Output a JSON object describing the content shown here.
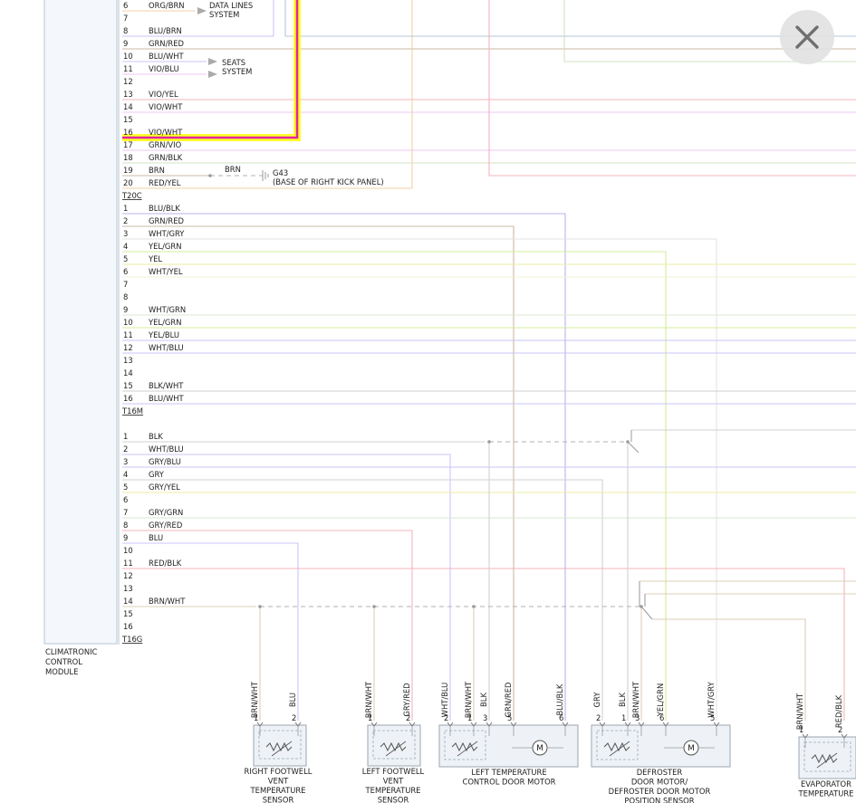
{
  "colors": {
    "wire_grn_red": "#cbb9a6",
    "wire_blu_blk": "#b7b3ee",
    "wire_wht_gry": "#e6e6e6",
    "wire_yel_grn": "#d6ec9c",
    "wire_yel": "#eeeea6",
    "wire_wht_grn": "#dcead2",
    "wire_blu": "#c9c5f7",
    "wire_gry": "#d2d2d2",
    "wire_red": "#f4b3bb",
    "wire_vio": "#ecc7f6",
    "wire_org": "#f6cfa5",
    "highlight_yellow": "#ffff2a",
    "highlight_magenta": "#e0259e",
    "module_fill": "#f4f8fc"
  },
  "module": {
    "name_lines": [
      "CLIMATRONIC",
      "CONTROL",
      "MODULE"
    ]
  },
  "connectors": [
    {
      "id": "T20C",
      "pins": [
        {
          "n": "6",
          "color": "ORG/BRN"
        },
        {
          "n": "7",
          "color": ""
        },
        {
          "n": "8",
          "color": "BLU/BRN"
        },
        {
          "n": "9",
          "color": "GRN/RED"
        },
        {
          "n": "10",
          "color": "BLU/WHT"
        },
        {
          "n": "11",
          "color": "VIO/BLU"
        },
        {
          "n": "12",
          "color": ""
        },
        {
          "n": "13",
          "color": "VIO/YEL"
        },
        {
          "n": "14",
          "color": "VIO/WHT"
        },
        {
          "n": "15",
          "color": ""
        },
        {
          "n": "16",
          "color": "VIO/WHT"
        },
        {
          "n": "17",
          "color": "GRN/VIO"
        },
        {
          "n": "18",
          "color": "GRN/BLK"
        },
        {
          "n": "19",
          "color": "BRN"
        },
        {
          "n": "20",
          "color": "RED/YEL"
        }
      ]
    },
    {
      "id": "T16M",
      "pins": [
        {
          "n": "1",
          "color": "BLU/BLK"
        },
        {
          "n": "2",
          "color": "GRN/RED"
        },
        {
          "n": "3",
          "color": "WHT/GRY"
        },
        {
          "n": "4",
          "color": "YEL/GRN"
        },
        {
          "n": "5",
          "color": "YEL"
        },
        {
          "n": "6",
          "color": "WHT/YEL"
        },
        {
          "n": "7",
          "color": ""
        },
        {
          "n": "8",
          "color": ""
        },
        {
          "n": "9",
          "color": "WHT/GRN"
        },
        {
          "n": "10",
          "color": "YEL/GRN"
        },
        {
          "n": "11",
          "color": "YEL/BLU"
        },
        {
          "n": "12",
          "color": "WHT/BLU"
        },
        {
          "n": "13",
          "color": ""
        },
        {
          "n": "14",
          "color": ""
        },
        {
          "n": "15",
          "color": "BLK/WHT"
        },
        {
          "n": "16",
          "color": "BLU/WHT"
        }
      ]
    },
    {
      "id": "T16G",
      "pins": [
        {
          "n": "1",
          "color": "BLK"
        },
        {
          "n": "2",
          "color": "WHT/BLU"
        },
        {
          "n": "3",
          "color": "GRY/BLU"
        },
        {
          "n": "4",
          "color": "GRY"
        },
        {
          "n": "5",
          "color": "GRY/YEL"
        },
        {
          "n": "6",
          "color": ""
        },
        {
          "n": "7",
          "color": "GRY/GRN"
        },
        {
          "n": "8",
          "color": "GRY/RED"
        },
        {
          "n": "9",
          "color": "BLU"
        },
        {
          "n": "10",
          "color": ""
        },
        {
          "n": "11",
          "color": "RED/BLK"
        },
        {
          "n": "12",
          "color": ""
        },
        {
          "n": "13",
          "color": ""
        },
        {
          "n": "14",
          "color": "BRN/WHT"
        },
        {
          "n": "15",
          "color": ""
        },
        {
          "n": "16",
          "color": ""
        }
      ]
    }
  ],
  "refs": {
    "data_lines": [
      "DATA LINES",
      "SYSTEM"
    ],
    "seats": [
      "SEATS",
      "SYSTEM"
    ],
    "ground_wire": "BRN",
    "ground_id": "G43",
    "ground_loc": "(BASE OF RIGHT KICK PANEL)"
  },
  "components": [
    {
      "id": "rfw",
      "label_lines": [
        "RIGHT FOOTWELL",
        "VENT",
        "TEMPERATURE",
        "SENSOR"
      ],
      "wires": [
        {
          "pin": "1",
          "color": "BRN/WHT"
        },
        {
          "pin": "2",
          "color": "BLU"
        }
      ]
    },
    {
      "id": "lfw",
      "label_lines": [
        "LEFT FOOTWELL",
        "VENT",
        "TEMPERATURE",
        "SENSOR"
      ],
      "wires": [
        {
          "pin": "1",
          "color": "BRN/WHT"
        },
        {
          "pin": "2",
          "color": "GRY/RED"
        }
      ]
    },
    {
      "id": "ltd",
      "label_lines": [
        "LEFT TEMPERATURE",
        "CONTROL DOOR MOTOR"
      ],
      "motor": "M",
      "wires": [
        {
          "pin": "2",
          "color": "WHT/BLU"
        },
        {
          "pin": "1",
          "color": "BRN/WHT"
        },
        {
          "pin": "3",
          "color": "BLK"
        },
        {
          "pin": "5",
          "color": "GRN/RED"
        },
        {
          "pin": "6",
          "color": "BLU/BLK"
        }
      ]
    },
    {
      "id": "dfr",
      "label_lines": [
        "DEFROSTER",
        "DOOR MOTOR/",
        "DEFROSTER DOOR MOTOR",
        "POSITION SENSOR"
      ],
      "motor": "M",
      "wires": [
        {
          "pin": "2",
          "color": "GRY"
        },
        {
          "pin": "1",
          "color": "BLK"
        },
        {
          "pin": "3",
          "color": "BRN/WHT"
        },
        {
          "pin": "6",
          "color": "YEL/GRN"
        },
        {
          "pin": "5",
          "color": "WHT/GRY"
        }
      ]
    },
    {
      "id": "evp",
      "label_lines": [
        "EVAPORATOR",
        "TEMPERATURE"
      ],
      "wires": [
        {
          "pin": "1",
          "color": "BRN/WHT"
        },
        {
          "pin": "2",
          "color": "RED/BLK"
        }
      ]
    }
  ]
}
